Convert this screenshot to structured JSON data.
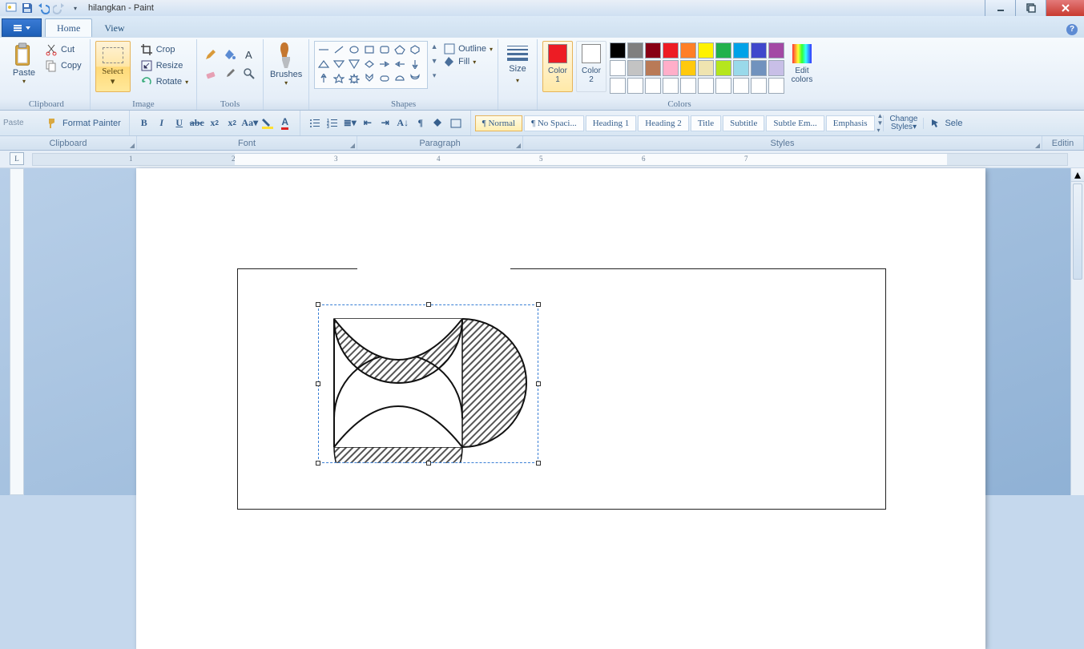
{
  "title": "hilangkan - Paint",
  "tabs": {
    "home": "Home",
    "view": "View"
  },
  "groups": {
    "clipboard": {
      "label": "Clipboard",
      "paste": "Paste",
      "cut": "Cut",
      "copy": "Copy"
    },
    "image": {
      "label": "Image",
      "select": "Select",
      "crop": "Crop",
      "resize": "Resize",
      "rotate": "Rotate"
    },
    "tools": {
      "label": "Tools"
    },
    "brushes": {
      "label": "Brushes"
    },
    "shapes": {
      "label": "Shapes",
      "outline": "Outline",
      "fill": "Fill"
    },
    "size": {
      "label": "Size"
    },
    "colors": {
      "label": "Colors",
      "c1": "Color\n1",
      "c2": "Color\n2",
      "edit": "Edit\ncolors",
      "row1": [
        "#000000",
        "#7f7f7f",
        "#880015",
        "#ed1c24",
        "#ff7f27",
        "#fff200",
        "#22b14c",
        "#00a2e8",
        "#3f48cc",
        "#a349a4"
      ],
      "row2": [
        "#ffffff",
        "#c3c3c3",
        "#b97a57",
        "#ffaec9",
        "#ffc90e",
        "#efe4b0",
        "#b5e61d",
        "#99d9ea",
        "#7092be",
        "#c8bfe7"
      ],
      "row3": [
        "#ffffff",
        "#ffffff",
        "#ffffff",
        "#ffffff",
        "#ffffff",
        "#ffffff",
        "#ffffff",
        "#ffffff",
        "#ffffff",
        "#ffffff"
      ],
      "color1_value": "#ed1c24",
      "color2_value": "#ffffff"
    }
  },
  "word": {
    "paste_stub": "Paste",
    "format_painter": "Format Painter",
    "group_clipboard": "Clipboard",
    "group_font": "Font",
    "group_paragraph": "Paragraph",
    "group_styles": "Styles",
    "group_editing": "Editin",
    "styles": [
      "¶ Normal",
      "¶ No Spaci...",
      "Heading 1",
      "Heading 2",
      "Title",
      "Subtitle",
      "Subtle Em...",
      "Emphasis"
    ],
    "change_styles": "Change Styles",
    "select_stub": "Sele"
  },
  "ruler_numbers": [
    "1",
    "2",
    "3",
    "4",
    "5",
    "6",
    "7"
  ]
}
